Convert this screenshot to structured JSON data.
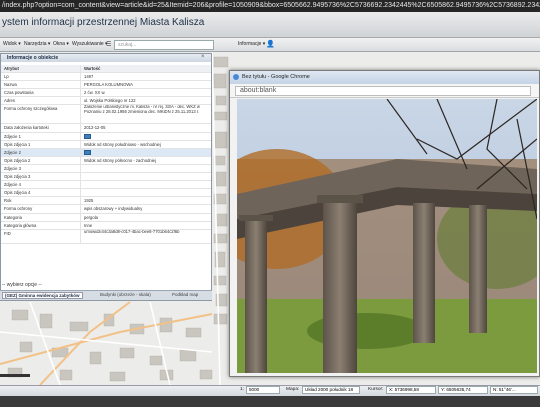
{
  "browser": {
    "url": "/index.php?option=com_content&view=article&id=25&Itemid=206&profile=1050909&bbox=6505662.9495736%2C5736692.2342445%2C6505862.9495736%2C5736892.2342445"
  },
  "app": {
    "title": "ystem informacji przestrzennej Miasta Kalisza"
  },
  "toolbar": {
    "menu1": "Widok ▾",
    "menu2": "Narzędzia ▾",
    "menu3": "Okna ▾",
    "menu4": "Wyszukiwanie ▾",
    "search_placeholder": "szukaj...",
    "info_label": "Informacje ▾"
  },
  "panel": {
    "title": "Informacje o obiekcie",
    "header": {
      "key": "Atrybut",
      "value": "Wartość"
    },
    "rows": [
      {
        "k": "Lp",
        "v": "1497"
      },
      {
        "k": "Nazwa",
        "v": "PERGOLA KOLUMNOWA"
      },
      {
        "k": "Czas powstania",
        "v": "2 ćw. XX w."
      },
      {
        "k": "Adres",
        "v": "ul. Wojska Polskiego nr 122"
      },
      {
        "k": "Forma ochrony szczegółowa",
        "v": "Założenie urbanistyczne m. Kalisza - nr rej. 33/A - dec. WKZ w Poznaniu z 28.02.1956 zmieniona dec. MKiDN z 25.11.2013 r."
      },
      {
        "k": "Data założenia kartoteki",
        "v": "2012-12-05"
      },
      {
        "k": "Zdjęcie 1",
        "v": ""
      },
      {
        "k": "Opis zdjęcia 1",
        "v": "Widok od strony południowo - wschodniej"
      },
      {
        "k": "Zdjęcie 2",
        "v": ""
      },
      {
        "k": "Opis zdjęcia 2",
        "v": "Widok od strony północno - zachodniej"
      },
      {
        "k": "Zdjęcie 3",
        "v": ""
      },
      {
        "k": "Opis zdjęcia 3",
        "v": ""
      },
      {
        "k": "Zdjęcie 4",
        "v": ""
      },
      {
        "k": "Opis zdjęcia 4",
        "v": ""
      },
      {
        "k": "Rok",
        "v": "1925"
      },
      {
        "k": "Forma ochrony",
        "v": "wpis obszarowy + indywidualny"
      },
      {
        "k": "Kategoria",
        "v": "pergola"
      },
      {
        "k": "Kategoria główna",
        "v": "Inne"
      },
      {
        "k": "FID",
        "v": "umowidzi44c3a8d8-c017-4bac-bee8-7701b64c2f6b"
      }
    ],
    "select_label": "-- wybierz opcje --",
    "tabs": [
      "(GEZ) Gminna ewidencja zabytków",
      "Budynki (obrzeże - skala)",
      "Podkład map"
    ]
  },
  "chrome": {
    "title": "Bez tytułu - Google Chrome",
    "address": "about:blank"
  },
  "statusbar": {
    "scale_label": "1:",
    "scale_value": "5000",
    "map_label": "Mapa:",
    "crs_value": "Układ 2000 południk 18",
    "coord_label": "Kursor:",
    "x_value": "X: 5736998,58",
    "y_value": "Y: 6505635,74",
    "geo_value": "N: 51°46'..."
  },
  "colors": {
    "accent": "#3f7fbf",
    "titlebar": "#1f3048"
  }
}
